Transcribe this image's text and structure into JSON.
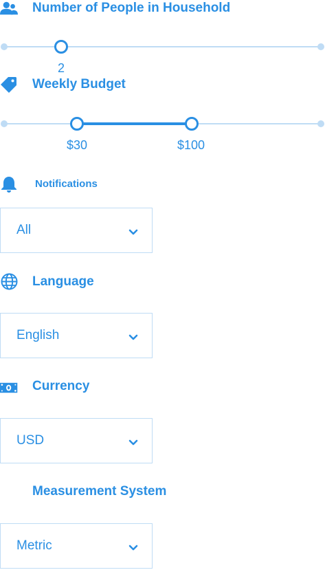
{
  "household": {
    "label": "Number of People in Household",
    "icon": "users-icon",
    "value": "2",
    "min": 1,
    "max": 12,
    "current": 2
  },
  "budget": {
    "label": "Weekly Budget",
    "icon": "tag-icon",
    "low_label": "$30",
    "high_label": "$100",
    "low": 30,
    "high": 100
  },
  "notifications": {
    "label": "Notifications",
    "icon": "bell-icon",
    "selected": "All"
  },
  "language": {
    "label": "Language",
    "icon": "globe-icon",
    "selected": "English"
  },
  "currency": {
    "label": "Currency",
    "icon": "money-bill-icon",
    "selected": "USD"
  },
  "measurement": {
    "label": "Measurement System",
    "selected": "Metric"
  },
  "colors": {
    "accent": "#2a8fe3",
    "track": "#bfdcf5"
  }
}
